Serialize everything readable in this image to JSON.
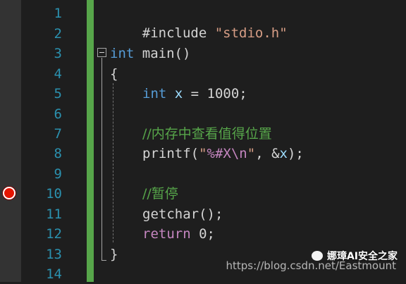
{
  "editor": {
    "line_numbers": [
      "1",
      "2",
      "3",
      "4",
      "5",
      "6",
      "7",
      "8",
      "9",
      "10",
      "11",
      "12",
      "13",
      "14"
    ],
    "breakpoint_line": "10",
    "colors": {
      "background": "#1e1e1e",
      "line_number": "#2b91af",
      "change_bar": "#57a64a",
      "breakpoint": "#e51400",
      "keyword": "#569cd6",
      "string": "#d69d85",
      "comment": "#57a64a"
    },
    "code": {
      "l1_directive": "#include",
      "l1_header": "\"stdio.h\"",
      "l3_type": "int",
      "l3_rest": " main()",
      "l4_brace": "{",
      "l5_type": "int",
      "l5_var": " x",
      "l5_rest": " = 1000;",
      "l7_comment": "//内存中查看值得位置",
      "l8_func": "printf(",
      "l8_str_open": "\"",
      "l8_fmt": "%#X\\n",
      "l8_str_close": "\"",
      "l8_rest_a": ", &",
      "l8_rest_var": "x",
      "l8_rest_b": ");",
      "l10_comment": "//暂停",
      "l11_call": "getchar();",
      "l12_kw": "return",
      "l12_rest": " 0;",
      "l13_brace": "}"
    }
  },
  "watermark": {
    "name": "娜璋AI安全之家",
    "url": "https://blog.csdn.net/Eastmount"
  }
}
